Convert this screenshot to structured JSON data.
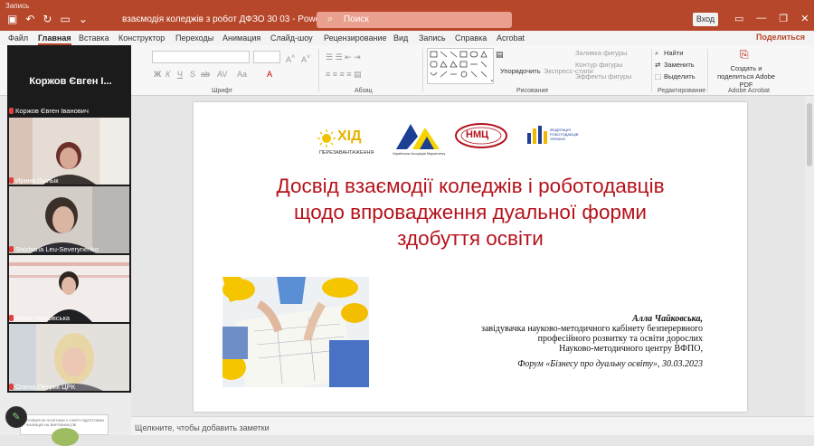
{
  "titlebar": {
    "recording_label": "Запись",
    "document_title": "взаємодія коледжів з робот ДФЗО 30 03  -  PowerPoint",
    "search_placeholder": "Поиск",
    "signin_label": "Вход",
    "accent_color": "#b7472a"
  },
  "tabs": [
    {
      "label": "Файл"
    },
    {
      "label": "Главная",
      "active": true
    },
    {
      "label": "Вставка"
    },
    {
      "label": "Конструктор"
    },
    {
      "label": "Переходы"
    },
    {
      "label": "Анимация"
    },
    {
      "label": "Слайд-шоу"
    },
    {
      "label": "Рецензирование"
    },
    {
      "label": "Вид"
    },
    {
      "label": "Запись"
    },
    {
      "label": "Справка"
    },
    {
      "label": "Acrobat"
    }
  ],
  "share_label": "Поделиться",
  "ribbon": {
    "group_font": "Шрифт",
    "group_paragraph": "Абзац",
    "group_drawing": "Рисование",
    "group_editing": "Редактирование",
    "group_acrobat": "Adobe Acrobat",
    "arrange_label": "Упорядочить",
    "quick_styles_label": "Экспресс-стили",
    "shape_fill_label": "Заливка фигуры",
    "shape_outline_label": "Контур фигуры",
    "shape_effects_label": "Эффекты фигуры",
    "find_label": "Найти",
    "replace_label": "Заменить",
    "select_label": "Выделить",
    "create_share_label": "Создать и поделиться Adobe PDF"
  },
  "meeting": {
    "host_name": "Коржов Євген І...",
    "participants": [
      {
        "name": "Коржов Євген Іванович"
      },
      {
        "name": "Ирина Лылык"
      },
      {
        "name": "Snizhana Leu-Severynenko"
      },
      {
        "name": "Алла Чайковська"
      },
      {
        "name": "Олена Петрик ЦРК"
      }
    ]
  },
  "thumbnail_peek": {
    "number": "2",
    "text": "РОЗВИТОК ПОЛІТИКИ У СФЕРІ ПІДГОТОВКИ ФАХІВЦІВ НА ВИРОБНИЦТВІ"
  },
  "slide": {
    "logos": [
      {
        "text": "ПЕРЕЗАВАНТАЖЕННЯ",
        "mark": "ХІД"
      },
      {
        "text": "Українська Асоціація Маркетингу"
      },
      {
        "text": "НМЦ"
      },
      {
        "text": "ФЕДЕРАЦІЯ РОБОТОДАВЦІВ УКРАЇНИ"
      }
    ],
    "title_line1": "Досвід взаємодії коледжів і роботодавців",
    "title_line2": "щодо впровадження дуальної форми",
    "title_line3": "здобуття освіти",
    "author_name": "Алла Чайковська,",
    "author_line1": "завідувачка науково-методичного кабінету безперервного",
    "author_line2": "професійного розвитку та освіти дорослих",
    "author_line3": "Науково-методичного центру ВФПО,",
    "forum": "Форум «Бізнесу про дуальну освіту»,  30.03.2023"
  },
  "notes_placeholder": "Щелкните, чтобы добавить заметки"
}
